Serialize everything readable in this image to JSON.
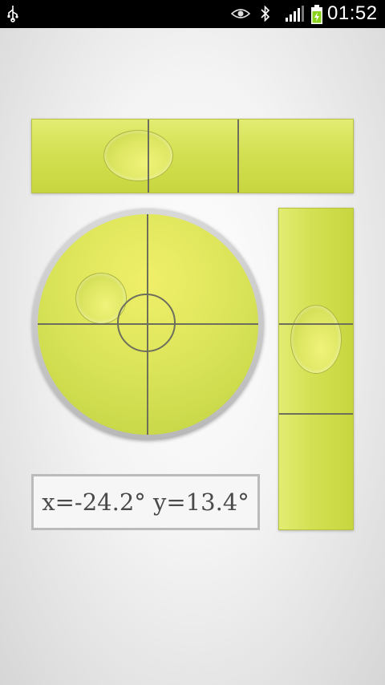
{
  "status_bar": {
    "time": "01:52",
    "icons": [
      "usb-icon",
      "eye-icon",
      "bluetooth-icon",
      "signal-icon",
      "battery-charging-icon"
    ]
  },
  "readout": {
    "text": "x=-24.2° y=13.4°"
  },
  "colors": {
    "vial_green": "#d3e052",
    "bubble_yellow": "#f0f37a",
    "tick_line": "#6d6f5c",
    "rim_gray": "#b8b8b8"
  }
}
